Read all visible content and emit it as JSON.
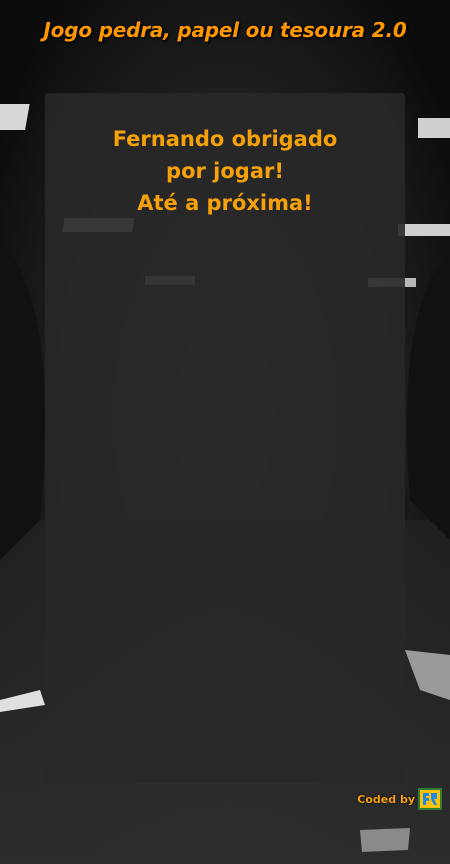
{
  "app": {
    "title": "Jogo pedra, papel ou tesoura 2.0"
  },
  "farewell": {
    "lines": [
      "Fernando obrigado",
      "por jogar!",
      "Até a próxima!"
    ]
  },
  "footer": {
    "credit_label": "Coded by",
    "logo_icon": "author-logo-icon"
  },
  "colors": {
    "accent": "#f5a10c",
    "panel": "#282828",
    "background": "#1a1a1a"
  }
}
